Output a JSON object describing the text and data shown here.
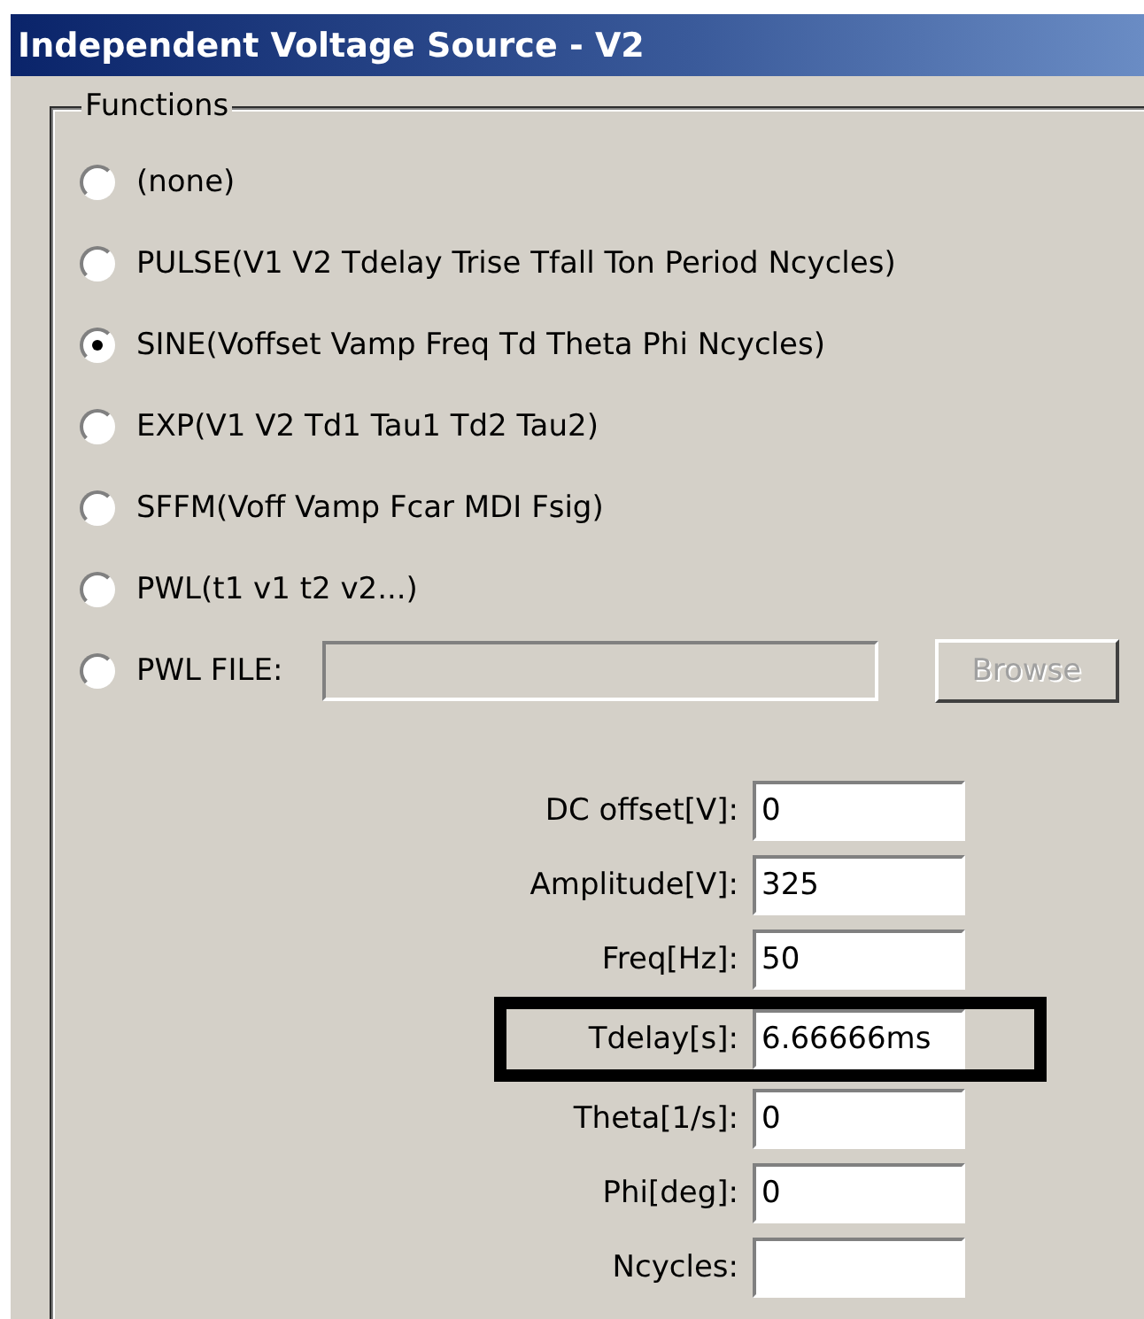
{
  "window": {
    "title": "Independent Voltage Source - V2"
  },
  "functions": {
    "title": "Functions",
    "options": [
      {
        "label": "(none)",
        "selected": false
      },
      {
        "label": "PULSE(V1 V2 Tdelay Trise Tfall Ton Period Ncycles)",
        "selected": false
      },
      {
        "label": "SINE(Voffset Vamp Freq Td Theta Phi Ncycles)",
        "selected": true
      },
      {
        "label": "EXP(V1 V2 Td1 Tau1 Td2 Tau2)",
        "selected": false
      },
      {
        "label": "SFFM(Voff Vamp Fcar MDI Fsig)",
        "selected": false
      },
      {
        "label": "PWL(t1 v1 t2 v2...)",
        "selected": false
      },
      {
        "label": "PWL FILE:",
        "selected": false,
        "kind": "file"
      }
    ],
    "file_field": {
      "disabled": true
    },
    "browse_button": {
      "label": "Browse",
      "disabled": true
    }
  },
  "parameters": [
    {
      "label": "DC offset[V]:",
      "value": "0",
      "highlighted": false
    },
    {
      "label": "Amplitude[V]:",
      "value": "325",
      "highlighted": false
    },
    {
      "label": "Freq[Hz]:",
      "value": "50",
      "highlighted": false
    },
    {
      "label": "Tdelay[s]:",
      "value": "6.66666ms",
      "highlighted": true
    },
    {
      "label": "Theta[1/s]:",
      "value": "0",
      "highlighted": false
    },
    {
      "label": "Phi[deg]:",
      "value": "0",
      "highlighted": false
    },
    {
      "label": "Ncycles:",
      "highlighted": false
    }
  ]
}
